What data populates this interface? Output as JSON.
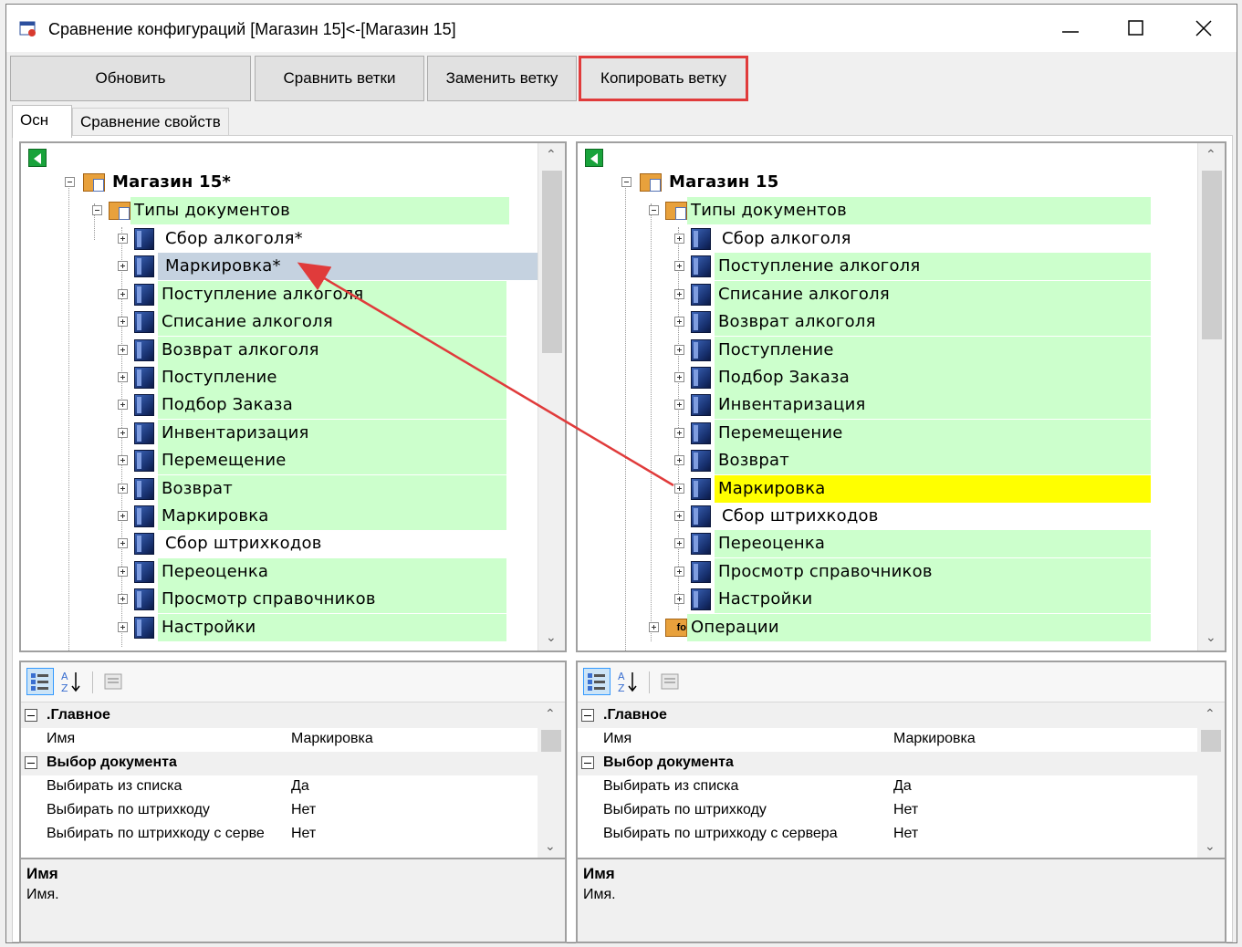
{
  "window": {
    "title": "Сравнение конфигураций [Магазин 15]<-[Магазин 15]"
  },
  "toolbar": {
    "refresh": "Обновить",
    "compare_branches": "Сравнить ветки",
    "replace_branch": "Заменить ветку",
    "copy_branch": "Копировать ветку"
  },
  "tabs": [
    "Осн",
    "Сравнение свойств"
  ],
  "left_tree": {
    "root": "Магазин 15*",
    "group": "Типы документов",
    "items": [
      {
        "label": "Сбор алкоголя*",
        "state": "white"
      },
      {
        "label": "Маркировка*",
        "state": "selected"
      },
      {
        "label": "Поступление алкоголя",
        "state": "green"
      },
      {
        "label": "Списание алкоголя",
        "state": "green"
      },
      {
        "label": "Возврат алкоголя",
        "state": "green"
      },
      {
        "label": "Поступление",
        "state": "green"
      },
      {
        "label": "Подбор Заказа",
        "state": "green"
      },
      {
        "label": "Инвентаризация",
        "state": "green"
      },
      {
        "label": "Перемещение",
        "state": "green"
      },
      {
        "label": "Возврат",
        "state": "green"
      },
      {
        "label": "Маркировка",
        "state": "green"
      },
      {
        "label": "Сбор штрихкодов",
        "state": "white"
      },
      {
        "label": "Переоценка",
        "state": "green"
      },
      {
        "label": "Просмотр справочников",
        "state": "green"
      },
      {
        "label": "Настройки",
        "state": "green"
      }
    ]
  },
  "right_tree": {
    "root": "Магазин 15",
    "group": "Типы документов",
    "items": [
      {
        "label": "Сбор алкоголя",
        "state": "white"
      },
      {
        "label": "Поступление алкоголя",
        "state": "green"
      },
      {
        "label": "Списание алкоголя",
        "state": "green"
      },
      {
        "label": "Возврат алкоголя",
        "state": "green"
      },
      {
        "label": "Поступление",
        "state": "green"
      },
      {
        "label": "Подбор Заказа",
        "state": "green"
      },
      {
        "label": "Инвентаризация",
        "state": "green"
      },
      {
        "label": "Перемещение",
        "state": "green"
      },
      {
        "label": "Возврат",
        "state": "green"
      },
      {
        "label": "Маркировка",
        "state": "yellow"
      },
      {
        "label": "Сбор штрихкодов",
        "state": "white"
      },
      {
        "label": "Переоценка",
        "state": "green"
      },
      {
        "label": "Просмотр справочников",
        "state": "green"
      },
      {
        "label": "Настройки",
        "state": "green"
      }
    ],
    "operations": "Операции"
  },
  "left_props": {
    "cat_main": ".Главное",
    "rows_main": [
      {
        "name": "Имя",
        "value": "Маркировка"
      }
    ],
    "cat_doc": "Выбор документа",
    "rows_doc": [
      {
        "name": "Выбирать из списка",
        "value": "Да"
      },
      {
        "name": "Выбирать по штрихкоду",
        "value": "Нет"
      },
      {
        "name": "Выбирать по штрихкоду с серве",
        "value": "Нет"
      }
    ],
    "desc_title": "Имя",
    "desc_text": "Имя."
  },
  "right_props": {
    "cat_main": ".Главное",
    "rows_main": [
      {
        "name": "Имя",
        "value": "Маркировка"
      }
    ],
    "cat_doc": "Выбор документа",
    "rows_doc": [
      {
        "name": "Выбирать из списка",
        "value": "Да"
      },
      {
        "name": "Выбирать по штрихкоду",
        "value": "Нет"
      },
      {
        "name": "Выбирать по штрихкоду с сервера",
        "value": "Нет"
      }
    ],
    "desc_title": "Имя",
    "desc_text": "Имя."
  },
  "colors": {
    "green": "#ccffcc",
    "yellow": "#ffff00",
    "selected": "#c5d2e0",
    "highlight_border": "#e03b3b",
    "arrow": "#e03b3b"
  },
  "icons": {
    "app": "compare-config-icon",
    "back": "back-arrow-icon",
    "root": "store-icon",
    "group": "folder-icon",
    "item": "document-type-icon",
    "operations": "operations-icon",
    "categorized": "categorized-icon",
    "alphabetical": "sort-az-icon",
    "property_pages": "property-pages-icon"
  }
}
